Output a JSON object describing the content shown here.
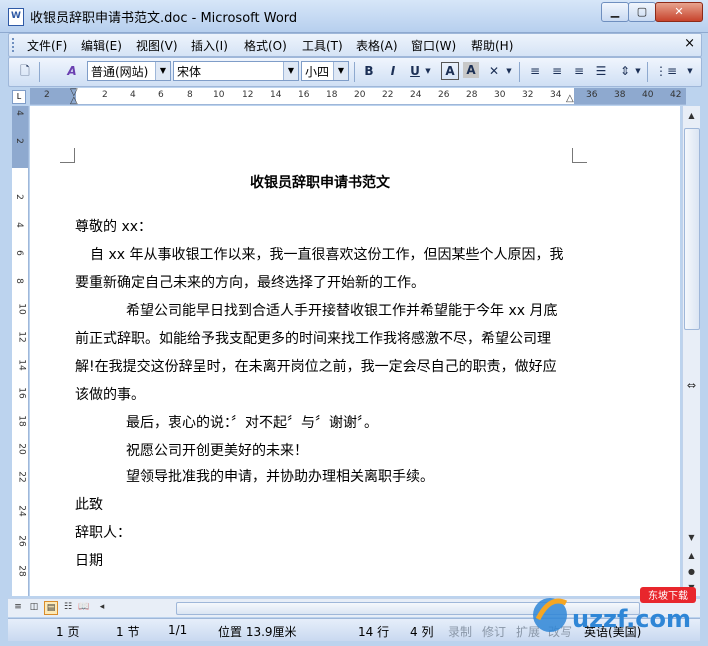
{
  "window": {
    "title": "收银员辞职申请书范文.doc - Microsoft Word",
    "minimize_icon": "minimize-icon",
    "maximize_icon": "maximize-icon",
    "close_icon": "close-icon"
  },
  "menu": {
    "items": [
      "文件(F)",
      "编辑(E)",
      "视图(V)",
      "插入(I)",
      "格式(O)",
      "工具(T)",
      "表格(A)",
      "窗口(W)",
      "帮助(H)"
    ],
    "close_label": "×"
  },
  "toolbar": {
    "style_value": "普通(网站)",
    "font_value": "宋体",
    "size_value": "小四",
    "bold": "B",
    "italic": "I",
    "underline": "U",
    "char_border": "A",
    "char_shading": "A"
  },
  "ruler": {
    "h_numbers": [
      "2",
      "2",
      "4",
      "6",
      "8",
      "10",
      "12",
      "14",
      "16",
      "18",
      "20",
      "22",
      "24",
      "26",
      "28",
      "30",
      "32",
      "34",
      "36",
      "38",
      "40",
      "42"
    ],
    "v_numbers": [
      "4",
      "2",
      "2",
      "4",
      "6",
      "8",
      "10",
      "12",
      "14",
      "16",
      "18",
      "20",
      "22",
      "24",
      "26",
      "28"
    ]
  },
  "document": {
    "title": "收银员辞职申请书范文",
    "lines": [
      "尊敬的 xx：",
      "自 xx 年从事收银工作以来，我一直很喜欢这份工作，但因某些个人原因，我",
      "要重新确定自己未来的方向，最终选择了开始新的工作。",
      "希望公司能早日找到合适人手开接替收银工作并希望能于今年 xx 月底",
      "前正式辞职。如能给予我支配更多的时间来找工作我将感激不尽，希望公司理",
      "解!在我提交这份辞呈时，在未离开岗位之前，我一定会尽自己的职责，做好应",
      "该做的事。",
      "最后，衷心的说：〞对不起〞与〞谢谢〞。",
      "祝愿公司开创更美好的未来！",
      "望领导批准我的申请，并协助办理相关离职手续。",
      "此致",
      "辞职人：",
      "日期"
    ]
  },
  "status": {
    "page": "1 页",
    "section": "1 节",
    "page_of": "1/1",
    "position": "位置 13.9厘米",
    "line": "14 行",
    "column": "4 列",
    "rec": "录制",
    "trk": "修订",
    "ext": "扩展",
    "ovr": "改写",
    "language": "英语(美国)"
  },
  "watermark": {
    "brand": "uzzf.com",
    "badge": "东坡下载"
  }
}
